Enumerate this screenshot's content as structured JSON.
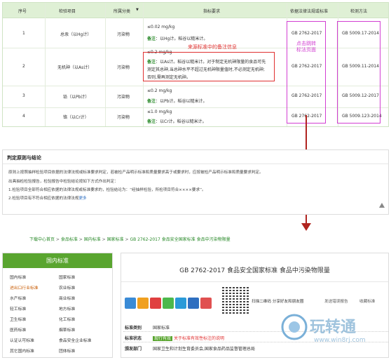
{
  "table": {
    "headers": [
      "序号",
      "检验项目",
      "所属分类",
      "指标要求",
      "依据法律法规或标准",
      "检测方法"
    ],
    "filter_icon": "triangle-down-icon",
    "rows": [
      {
        "no": "1",
        "item": "总汞（以Hg计）",
        "cat": "污染物",
        "req": "≤0.02  mg/kg",
        "note_key": "备注",
        "note": "：以Hg计。稻谷以糙米计。",
        "std": "GB 2762-2017",
        "method": "GB 5009.17-2014"
      },
      {
        "no": "2",
        "item": "无机砷（以As计）",
        "cat": "污染物",
        "req": "≤0.2  mg/kg",
        "note_key": "备注",
        "note": "：以As计。稻谷以糙米计。对于制定无机砷限量的食品可先",
        "note2": "测定其总砷,当总砷水平不超过无机砷限量值时,不必测定无机砷;",
        "note3": "否则,需再测定无机砷。",
        "std": "GB 2762-2017",
        "method": "GB 5009.11-2014"
      },
      {
        "no": "3",
        "item": "铅（以Pb计）",
        "cat": "污染物",
        "req": "≤0.2  mg/kg",
        "note_key": "备注",
        "note": "：以Pb计。稻谷以糙米计。",
        "std": "GB 2762-2017",
        "method": "GB 5009.12-2017"
      },
      {
        "no": "4",
        "item": "铬（以Cr计）",
        "cat": "污染物",
        "req": "≤1.0  mg/kg",
        "note_key": "备注",
        "note": "：以Cr计。稻谷以糙米计。",
        "std": "GB 2762-2017",
        "method": "GB 5009.123-2014"
      }
    ]
  },
  "annotations": {
    "red_label": "来源标准中的备注信息",
    "pink_label_1": "点击跳转",
    "pink_label_2": "标法页面"
  },
  "judge": {
    "title": "判定原则与结论",
    "lines": [
      "原则上按照抽样检验项目依据的法律法规或标准要求判定，若被检产品明示标准和质量要求高于或要求时，应按被检产品明示标准和质量要求判定。",
      "出具抽检检验报告，检验报告中检验结论按如下方式作出判定：",
      "1.检验项目全部符合相应依据的法律法规或标准要求的，检验结论为：“经抽样检验，所检项目符合××××要求”。",
      "2.检验项目有不符合相应依据的法律法规",
      "更多"
    ],
    "more_icon": "expand-arrow-icon"
  },
  "breadcrumb": {
    "parts": [
      "下载中心首页",
      "食品标准",
      "国内标准",
      "国家标准",
      "GB 2762-2017 食品安全国家标准 食品中污染物限量"
    ],
    "separator": " > "
  },
  "sidebar": {
    "title": "国内标准",
    "items": [
      "国内标准",
      "国家标准",
      "进出口行业标准",
      "农业标准",
      "水产标准",
      "商业标准",
      "轻工标准",
      "地方标准",
      "卫生标准",
      "化工标准",
      "医药标准",
      "烟草标准",
      "认证认可标准",
      "食品安全企业标准",
      "其它国内标准",
      "团体标准"
    ]
  },
  "standard": {
    "title": "GB 2762-2017  食品安全国家标准  食品中污染物限量",
    "share_icons": [
      "plus-share-icon",
      "star-icon",
      "weibo-icon",
      "wechat-icon",
      "qzone-icon",
      "renren-icon",
      "love-icon"
    ],
    "qr_caption": "扫描二维码  分享好友和朋友圈",
    "feedback": "发送错误报告",
    "favorite": "收藏标准",
    "info": [
      {
        "k": "标准类别",
        "v": "国家标准"
      },
      {
        "k": "标准状态",
        "tag": "现行有效",
        "v": "关于标准有效性标注的说明"
      },
      {
        "k": "颁发部门",
        "v": "国家卫生和计划生育委员会,国家食品药品监督管理总局"
      }
    ]
  },
  "watermark": {
    "text": "玩转通",
    "sub": "www.win8rj.com"
  },
  "colors": {
    "brand_green": "#59a52f",
    "note_green": "#2a8a2a",
    "annot_red": "#e03030",
    "annot_pink": "#d23ed2",
    "arrow": "#b0241f"
  }
}
